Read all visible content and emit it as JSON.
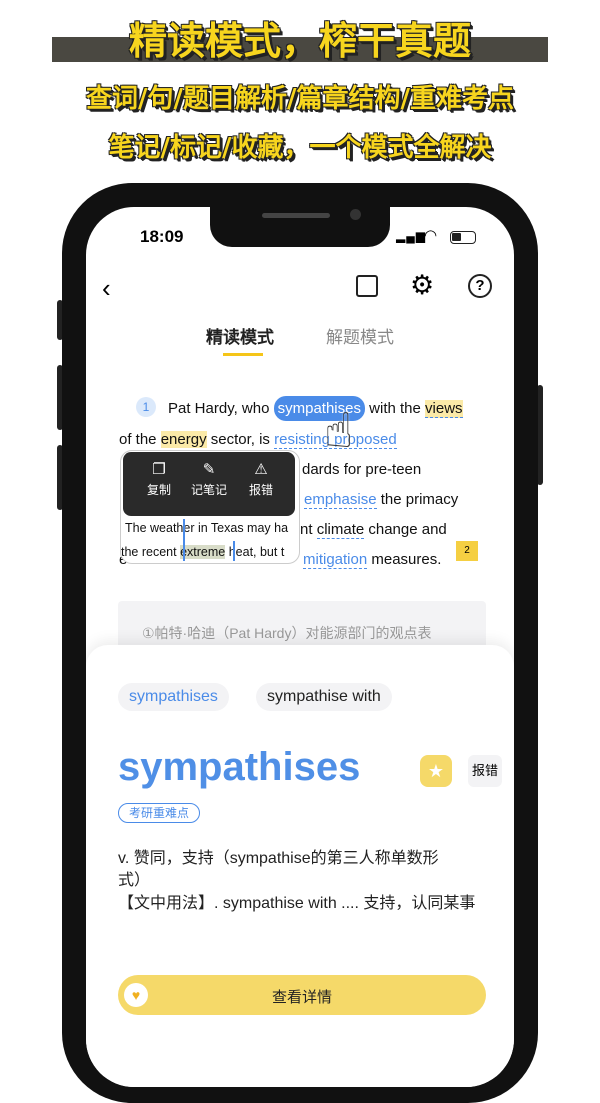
{
  "banner": {
    "title": "精读模式，榨干真题",
    "line2": "查词/句/题目解析/篇章结构/重难考点",
    "line3": "笔记/标记/收藏，一个模式全解决"
  },
  "status": {
    "time": "18:09"
  },
  "nav": {
    "icons": [
      "back-icon",
      "share-icon",
      "gear-icon",
      "help-icon"
    ]
  },
  "tabs": [
    {
      "label": "精读模式",
      "active": true
    },
    {
      "label": "解题模式",
      "active": false
    }
  ],
  "passage": {
    "para_num": "1",
    "l1": {
      "a": "Pat Hardy, who ",
      "word": "sympathises",
      "b": " with the ",
      "c": "views"
    },
    "l2": {
      "a": "of the ",
      "b": "energy",
      "c": " sector, is ",
      "d": "resisting proposed"
    },
    "l3": "dards for pre-teen",
    "l4": {
      "a": "emphasise",
      "b": " the primacy"
    },
    "l5": {
      "a": "nt ",
      "b": "climate",
      "c": " change and"
    },
    "l6": {
      "a": "e",
      "b": "mitigation",
      "c": " measures."
    },
    "flag_num": "2"
  },
  "popup": {
    "actions": [
      {
        "label": "复制",
        "icon": "copy-icon"
      },
      {
        "label": "记笔记",
        "icon": "pen-icon"
      },
      {
        "label": "报错",
        "icon": "warning-icon"
      }
    ],
    "line1": "The weather in Texas may ha",
    "line2a": "the recent ",
    "line2b": "extreme",
    "line2c": " heat, but t"
  },
  "translation": "①帕特·哈迪（Pat Hardy）对能源部门的观点表",
  "card": {
    "chips": [
      "sympathises",
      "sympathise with"
    ],
    "word": "sympathises",
    "report": "报错",
    "tag": "考研重难点",
    "def1": "v. 赞同，支持（sympathise的第三人称单数形式）",
    "def2": "【文中用法】. sympathise with .... 支持，认同某事",
    "detail_button": "查看详情"
  },
  "colors": {
    "accent": "#4a8be8",
    "yellow": "#f5d969"
  }
}
